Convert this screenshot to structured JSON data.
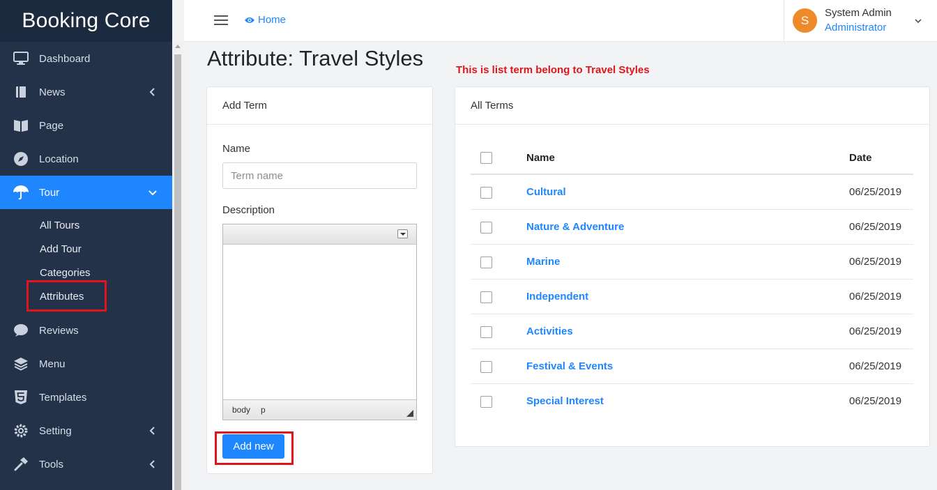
{
  "brand": "Booking Core",
  "sidebar": {
    "items": [
      {
        "label": "Dashboard",
        "icon": "monitor-icon"
      },
      {
        "label": "News",
        "icon": "book-icon",
        "chevron": "left"
      },
      {
        "label": "Page",
        "icon": "open-book-icon"
      },
      {
        "label": "Location",
        "icon": "compass-icon"
      },
      {
        "label": "Tour",
        "icon": "umbrella-icon",
        "chevron": "down",
        "active": true
      }
    ],
    "tour_sub": [
      "All Tours",
      "Add Tour",
      "Categories",
      "Attributes"
    ],
    "items_after": [
      {
        "label": "Reviews",
        "icon": "comment-icon"
      },
      {
        "label": "Menu",
        "icon": "layers-icon"
      },
      {
        "label": "Templates",
        "icon": "html5-icon"
      },
      {
        "label": "Setting",
        "icon": "gear-icon",
        "chevron": "left"
      },
      {
        "label": "Tools",
        "icon": "hammer-icon",
        "chevron": "left"
      }
    ]
  },
  "topbar": {
    "home": "Home",
    "user_initial": "S",
    "user_name": "System Admin",
    "user_role": "Administrator"
  },
  "page": {
    "title": "Attribute: Travel Styles",
    "note": "This is list term belong to Travel Styles"
  },
  "add_term": {
    "heading": "Add Term",
    "name_label": "Name",
    "name_placeholder": "Term name",
    "description_label": "Description",
    "editor_path": [
      "body",
      "p"
    ],
    "button": "Add new"
  },
  "all_terms": {
    "heading": "All Terms",
    "col_name": "Name",
    "col_date": "Date",
    "rows": [
      {
        "name": "Cultural",
        "date": "06/25/2019"
      },
      {
        "name": "Nature & Adventure",
        "date": "06/25/2019"
      },
      {
        "name": "Marine",
        "date": "06/25/2019"
      },
      {
        "name": "Independent",
        "date": "06/25/2019"
      },
      {
        "name": "Activities",
        "date": "06/25/2019"
      },
      {
        "name": "Festival & Events",
        "date": "06/25/2019"
      },
      {
        "name": "Special Interest",
        "date": "06/25/2019"
      }
    ]
  },
  "colors": {
    "sidebar_bg": "#233149",
    "accent": "#1e86ff",
    "highlight": "#e0151b",
    "avatar": "#ee8a2a"
  }
}
